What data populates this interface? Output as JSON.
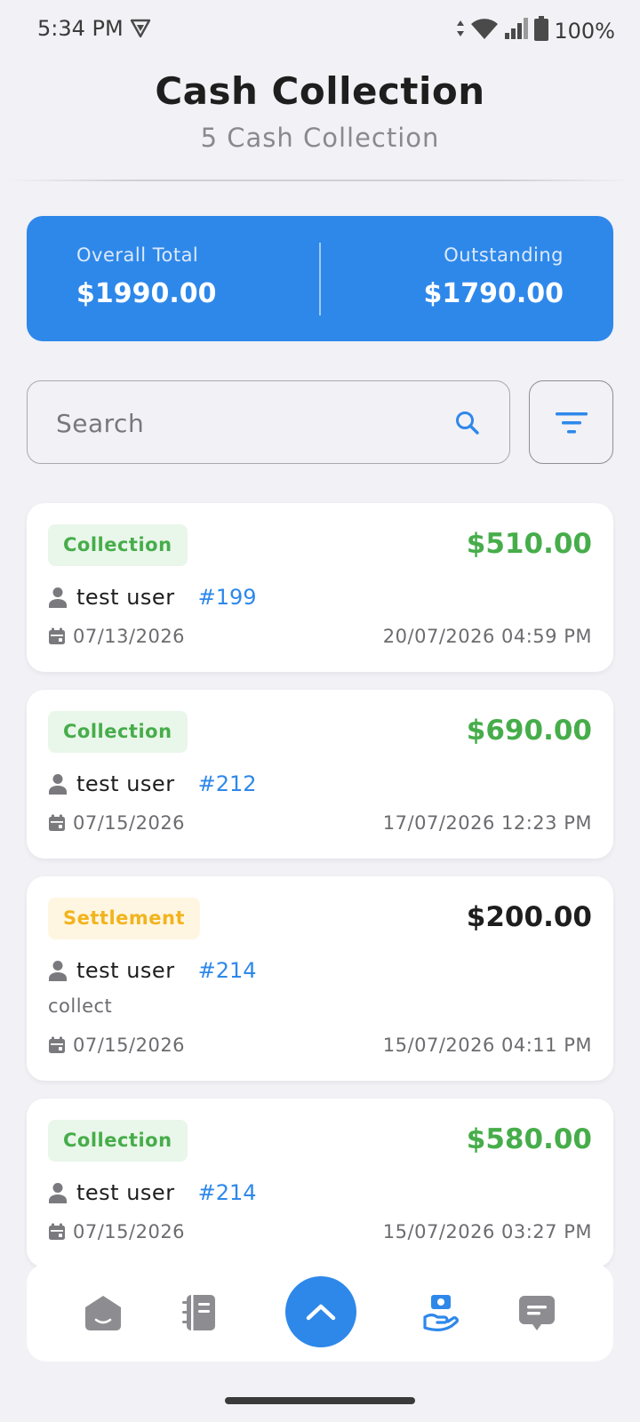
{
  "status_bar": {
    "time": "5:34 PM",
    "battery": "100%"
  },
  "header": {
    "title": "Cash Collection",
    "subtitle": "5 Cash Collection"
  },
  "summary": {
    "overall_label": "Overall Total",
    "overall_value": "$1990.00",
    "outstanding_label": "Outstanding",
    "outstanding_value": "$1790.00"
  },
  "search": {
    "placeholder": "Search",
    "value": ""
  },
  "cards": [
    {
      "type": "Collection",
      "amount": "$510.00",
      "user": "test user",
      "order": "#199",
      "date": "07/13/2026",
      "datetime": "20/07/2026 04:59 PM"
    },
    {
      "type": "Collection",
      "amount": "$690.00",
      "user": "test user",
      "order": "#212",
      "date": "07/15/2026",
      "datetime": "17/07/2026 12:23 PM"
    },
    {
      "type": "Settlement",
      "amount": "$200.00",
      "user": "test user",
      "order": "#214",
      "note": "collect",
      "date": "07/15/2026",
      "datetime": "15/07/2026 04:11 PM"
    },
    {
      "type": "Collection",
      "amount": "$580.00",
      "user": "test user",
      "order": "#214",
      "date": "07/15/2026",
      "datetime": "15/07/2026 03:27 PM"
    }
  ],
  "bottom_nav": {
    "items": [
      {
        "icon": "home-icon"
      },
      {
        "icon": "notebook-icon"
      },
      {
        "icon": "chevron-up-icon"
      },
      {
        "icon": "cash-hand-icon",
        "active": true
      },
      {
        "icon": "chat-icon"
      }
    ]
  },
  "colors": {
    "primary": "#2e88ea",
    "collection_green": "#46ad4a",
    "settlement_amber": "#f2b41c",
    "background": "#f1f1f6"
  }
}
